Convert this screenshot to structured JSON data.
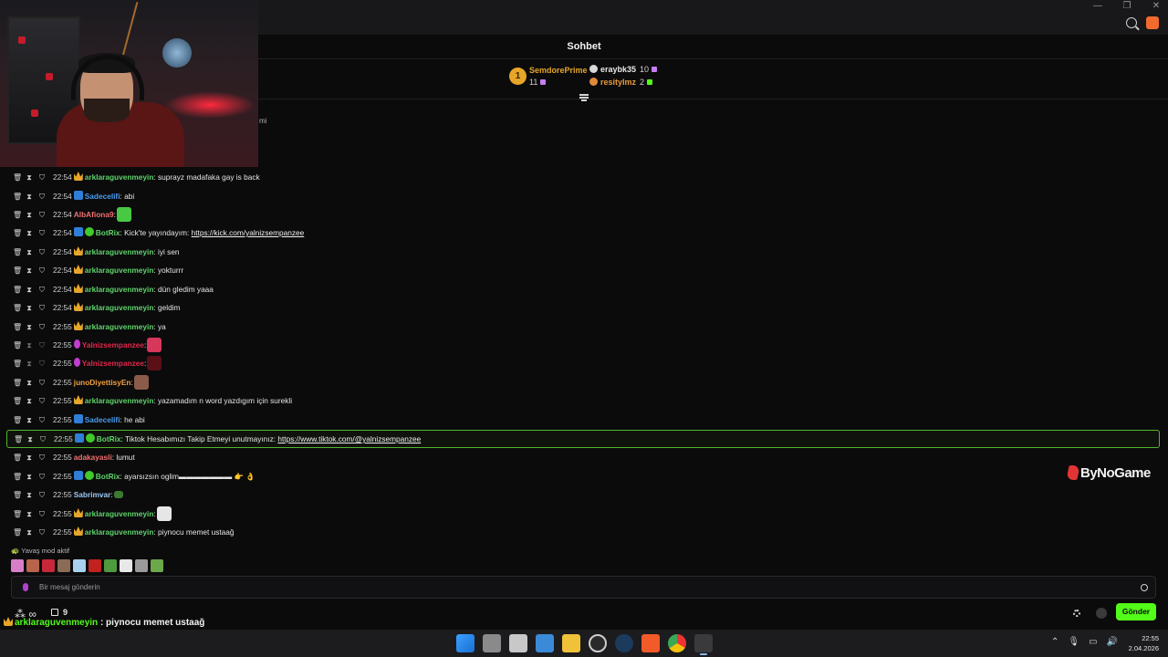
{
  "chat": {
    "title": "Sohbet",
    "leaderboard": {
      "rank1": {
        "rank": "1",
        "name": "SemdorePrime",
        "count": "11"
      },
      "rank2": {
        "name": "eraybk35",
        "count": "10"
      },
      "rank3": {
        "name": "resityImz",
        "count": "2"
      }
    },
    "cut_message": "mi",
    "messages": [
      {
        "time": "22:54",
        "user": "arklaraguvenmeyin",
        "text": " suprayz madafaka gay is back"
      },
      {
        "time": "22:54",
        "user": "Sadecelifi",
        "text": " abi"
      },
      {
        "time": "22:54",
        "user": "AlbAfiona9",
        "text": ""
      },
      {
        "time": "22:54",
        "user": "BotRix",
        "text": " Kick'te yayındayım: ",
        "link": "https://kick.com/yalnizsempanzee"
      },
      {
        "time": "22:54",
        "user": "arklaraguvenmeyin",
        "text": " iyi sen"
      },
      {
        "time": "22:54",
        "user": "arklaraguvenmeyin",
        "text": " yokturrr"
      },
      {
        "time": "22:54",
        "user": "arklaraguvenmeyin",
        "text": " dün gledim yaaa"
      },
      {
        "time": "22:54",
        "user": "arklaraguvenmeyin",
        "text": " geldim"
      },
      {
        "time": "22:55",
        "user": "arklaraguvenmeyin",
        "text": " ya"
      },
      {
        "time": "22:55",
        "user": "Yalnizsempanzee",
        "text": ""
      },
      {
        "time": "22:55",
        "user": "Yalnizsempanzee",
        "text": ""
      },
      {
        "time": "22:55",
        "user": "junoDiyettisyEn",
        "text": ""
      },
      {
        "time": "22:55",
        "user": "arklaraguvenmeyin",
        "text": " yazamadım n word yazdıgım için surekli"
      },
      {
        "time": "22:55",
        "user": "Sadecelifi",
        "text": " he abi"
      },
      {
        "time": "22:55",
        "user": "BotRix",
        "text": " Tiktok Hesabımızı Takip Etmeyi unutmayınız: ",
        "link": "https://www.tiktok.com/@yalnizsempanzee"
      },
      {
        "time": "22:55",
        "user": "adakayasli",
        "text": " lumut"
      },
      {
        "time": "22:55",
        "user": "BotRix",
        "text": " ayarsızsın oglim▬▬▬▬▬▬▬ 👉 👌"
      },
      {
        "time": "22:55",
        "user": "Sabrimvar",
        "text": ""
      },
      {
        "time": "22:55",
        "user": "arklaraguvenmeyin",
        "text": ""
      },
      {
        "time": "22:55",
        "user": "arklaraguvenmeyin",
        "text": " piynocu memet ustaağ"
      }
    ],
    "slow_mode": "Yavaş mod aktif",
    "input_placeholder": "Bir mesaj gönderin",
    "infinity": "∞",
    "calendar_count": "9",
    "send_label": "Gönder"
  },
  "overlay_message": {
    "user": "arklaraguvenmeyin",
    "text": " : piynocu memet ustaağ"
  },
  "watermark": "ByNoGame",
  "taskbar": {
    "time": "22:55",
    "date": "2.04.2026"
  },
  "colors": {
    "kick_green": "#53fc18",
    "gold": "#e7a62a",
    "user_green": "#5fd36b",
    "user_blue": "#4a9cf0",
    "user_red": "#e0284a",
    "user_orange": "#f0a040",
    "user_pink": "#f07070",
    "user_lightblue": "#9ac8f0"
  }
}
